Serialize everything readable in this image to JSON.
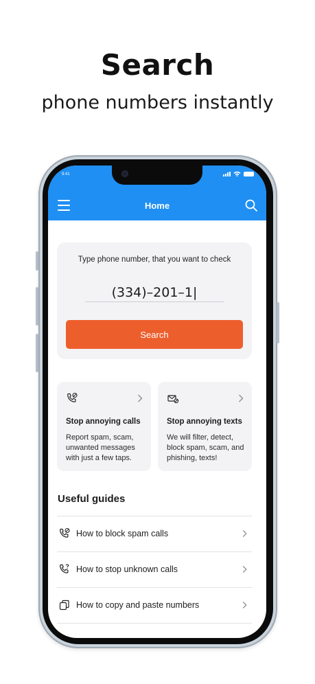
{
  "promo": {
    "headline": "Search",
    "subline": "phone numbers instantly"
  },
  "status_bar": {
    "time": "9:41"
  },
  "header": {
    "title": "Home",
    "bg_color": "#1f8ff3"
  },
  "search": {
    "prompt": "Type phone number, that you want to check",
    "value": "(334)–201–1|",
    "button_label": "Search",
    "button_color": "#ed5e2d"
  },
  "features": [
    {
      "icon": "phone-block-icon",
      "title": "Stop annoying calls",
      "description": "Report spam, scam, unwanted messages with just a few taps."
    },
    {
      "icon": "message-block-icon",
      "title": "Stop annoying texts",
      "description": "We will filter, detect, block spam, scam, and phishing, texts!"
    }
  ],
  "guides": {
    "heading": "Useful guides",
    "items": [
      {
        "icon": "phone-block-icon",
        "label": "How to block spam calls"
      },
      {
        "icon": "phone-question-icon",
        "label": "How to stop unknown calls"
      },
      {
        "icon": "copy-icon",
        "label": "How to copy and paste numbers"
      }
    ]
  }
}
